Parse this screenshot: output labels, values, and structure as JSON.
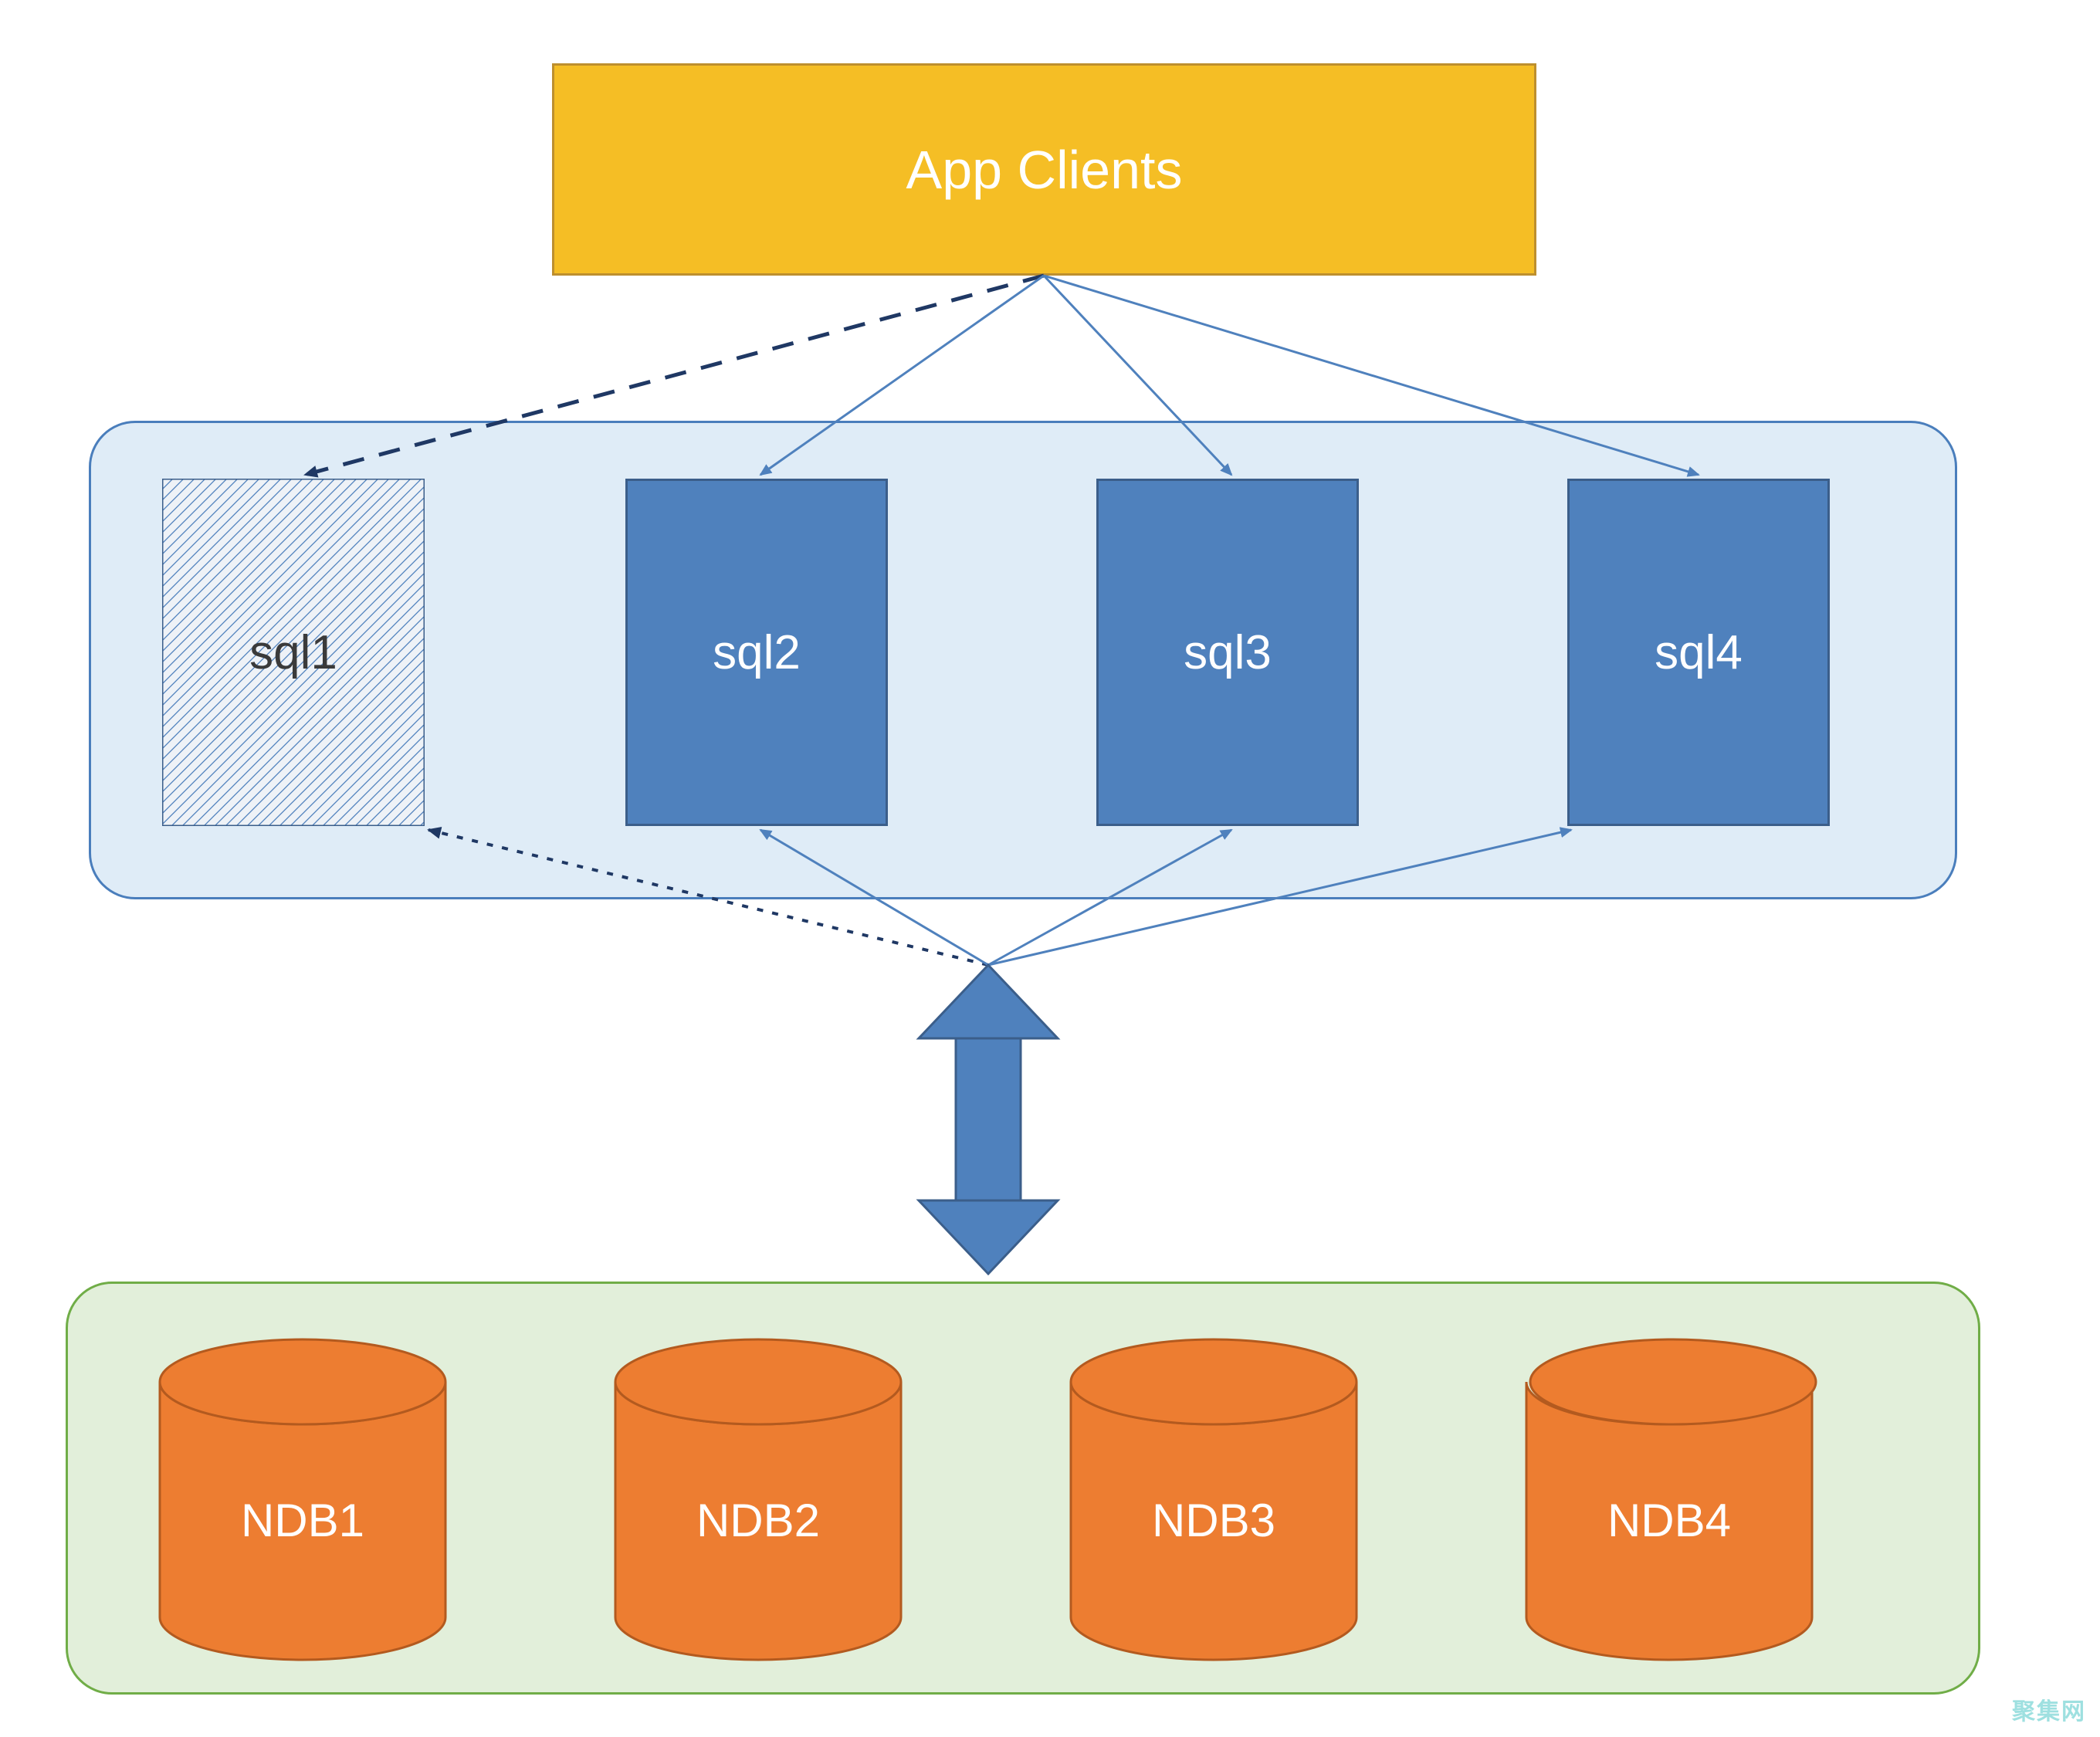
{
  "app_clients": {
    "label": "App Clients"
  },
  "sql_nodes": {
    "sql1": "sql1",
    "sql2": "sql2",
    "sql3": "sql3",
    "sql4": "sql4"
  },
  "ndb_nodes": {
    "ndb1": "NDB1",
    "ndb2": "NDB2",
    "ndb3": "NDB3",
    "ndb4": "NDB4"
  },
  "watermark": "聚集网",
  "colors": {
    "app_fill": "#F5BE25",
    "app_border": "#BD8F2E",
    "sql_container_fill": "#DFECF7",
    "sql_container_border": "#4A7EBC",
    "sql_box_fill": "#4F81BD",
    "sql_box_border": "#3B5E8A",
    "ndb_container_fill": "#E2EFDA",
    "ndb_container_border": "#70AD47",
    "cylinder_fill": "#ED7D31",
    "cylinder_border": "#B35A1F",
    "arrow_blue": "#4F81BD",
    "dashed_dark": "#1F3864"
  }
}
